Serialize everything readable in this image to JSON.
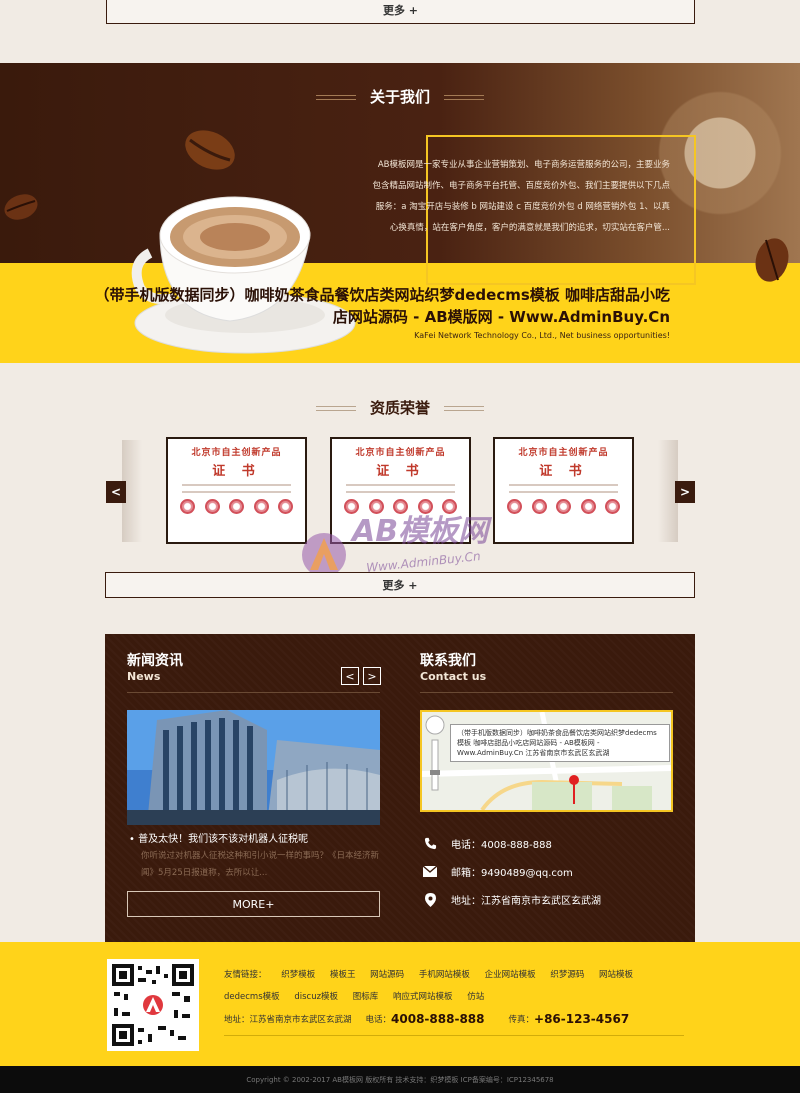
{
  "top": {
    "more_label": "更多 +"
  },
  "about": {
    "title": "关于我们",
    "description": "AB模板网是一家专业从事企业营销策划、电子商务运营服务的公司，主要业务包含精品网站制作、电子商务平台托管、百度竞价外包、我们主要提供以下几点服务：a 淘宝开店与装修 b 网站建设 c 百度竞价外包 d 网络营销外包 1、以真心换真情，站在客户角度，客户的满意就是我们的追求，切实站在客户管...",
    "headline": "（带手机版数据同步）咖啡奶茶食品餐饮店类网站织梦dedecms模板 咖啡店甜品小吃店网站源码 - AB模版网 - Www.AdminBuy.Cn",
    "subtitle": "KaFei Network Technology Co., Ltd., Net business opportunities!"
  },
  "honor": {
    "title": "资质荣誉",
    "prev": "<",
    "next": ">",
    "certificates": [
      {
        "head": "北京市自主创新产品",
        "big": "证 书"
      },
      {
        "head": "北京市自主创新产品",
        "big": "证 书"
      },
      {
        "head": "北京市自主创新产品",
        "big": "证 书"
      }
    ],
    "more_label": "更多 +"
  },
  "watermark": {
    "brand": "AB模板网",
    "url": "Www.AdminBuy.Cn"
  },
  "news": {
    "title": "新闻资讯",
    "title_en": "News",
    "prev": "<",
    "next": ">",
    "item_title": "普及太快！我们该不该对机器人征税呢",
    "item_desc": "你听说过对机器人征税这种和引小说一样的事吗？《日本经济新闻》5月25日报道称，去所以让...",
    "more_label": "MORE+"
  },
  "contact": {
    "title": "联系我们",
    "title_en": "Contact us",
    "map_popup": "（带手机版数据同步）咖啡奶茶食品餐饮店类网站织梦dedecms模板 咖啡店甜品小吃店网站源码 - AB模板网 - Www.AdminBuy.Cn 江苏省南京市玄武区玄武湖",
    "phone": "电话：4008-888-888",
    "email": "邮箱：9490489@qq.com",
    "address": "地址：江苏省南京市玄武区玄武湖"
  },
  "footer": {
    "links_label": "友情链接：",
    "links": [
      "织梦模板",
      "模板王",
      "网站源码",
      "手机网站模板",
      "企业网站模板",
      "织梦源码",
      "网站模板",
      "dedecms模板",
      "discuz模板",
      "图标库",
      "响应式网站模板",
      "仿站"
    ],
    "address": "地址：江苏省南京市玄武区玄武湖",
    "phone_label": "电话：",
    "phone": "4008-888-888",
    "fax_label": "传真：",
    "fax": "+86-123-4567",
    "copyright": "Copyright © 2002-2017 AB模板网 版权所有  技术支持：织梦模板  ICP备案编号：ICP12345678"
  },
  "colors": {
    "brown": "#3a1a0c",
    "yellow": "#ffd31a",
    "cream": "#f1ebe4",
    "gold": "#f5c623"
  },
  "icons": [
    "coffee-cup",
    "coffee-bean",
    "chevron-left-icon",
    "chevron-right-icon",
    "phone-icon",
    "mail-icon",
    "location-pin-icon",
    "qr-code"
  ]
}
